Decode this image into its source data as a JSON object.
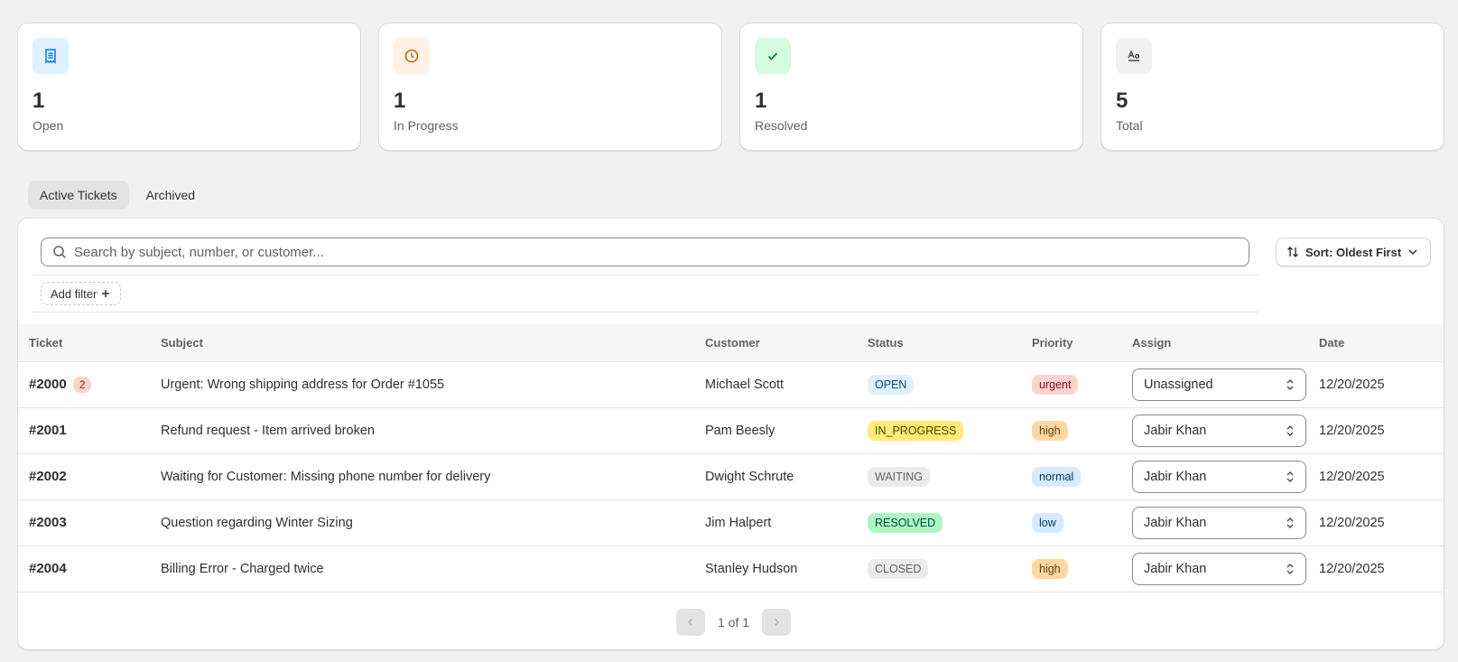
{
  "stats": [
    {
      "value": "1",
      "label": "Open",
      "icon": "receipt-icon",
      "icon_bg": "#e0f0ff",
      "icon_color": "#0b7bd9"
    },
    {
      "value": "1",
      "label": "In Progress",
      "icon": "clock-icon",
      "icon_bg": "#fff1e3",
      "icon_color": "#b8700a"
    },
    {
      "value": "1",
      "label": "Resolved",
      "icon": "check-icon",
      "icon_bg": "#d4fbdf",
      "icon_color": "#0c7a3b"
    },
    {
      "value": "5",
      "label": "Total",
      "icon": "text-format-icon",
      "icon_bg": "#f1f1f1",
      "icon_color": "#4a4a4a"
    }
  ],
  "tabs": [
    "Active Tickets",
    "Archived"
  ],
  "search": {
    "placeholder": "Search by subject, number, or customer..."
  },
  "sort": {
    "label": "Sort: Oldest First"
  },
  "filter": {
    "add_label": "Add filter"
  },
  "table": {
    "columns": [
      "Ticket",
      "Subject",
      "Customer",
      "Status",
      "Priority",
      "Assign",
      "Date"
    ],
    "rows": [
      {
        "ticket": "#2000",
        "count": "2",
        "subject": "Urgent: Wrong shipping address for Order #1055",
        "customer": "Michael Scott",
        "status": "OPEN",
        "priority": "urgent",
        "assign": "Unassigned",
        "date": "12/20/2025"
      },
      {
        "ticket": "#2001",
        "count": "",
        "subject": "Refund request - Item arrived broken",
        "customer": "Pam Beesly",
        "status": "IN_PROGRESS",
        "priority": "high",
        "assign": "Jabir Khan",
        "date": "12/20/2025"
      },
      {
        "ticket": "#2002",
        "count": "",
        "subject": "Waiting for Customer: Missing phone number for delivery",
        "customer": "Dwight Schrute",
        "status": "WAITING",
        "priority": "normal",
        "assign": "Jabir Khan",
        "date": "12/20/2025"
      },
      {
        "ticket": "#2003",
        "count": "",
        "subject": "Question regarding Winter Sizing",
        "customer": "Jim Halpert",
        "status": "RESOLVED",
        "priority": "low",
        "assign": "Jabir Khan",
        "date": "12/20/2025"
      },
      {
        "ticket": "#2004",
        "count": "",
        "subject": "Billing Error - Charged twice",
        "customer": "Stanley Hudson",
        "status": "CLOSED",
        "priority": "high",
        "assign": "Jabir Khan",
        "date": "12/20/2025"
      }
    ]
  },
  "status_colors": {
    "OPEN": {
      "bg": "#e0f0ff",
      "fg": "#00527c"
    },
    "IN_PROGRESS": {
      "bg": "#ffeb78",
      "fg": "#4f4700"
    },
    "WAITING": {
      "bg": "#ebebeb",
      "fg": "#616161"
    },
    "RESOLVED": {
      "bg": "#aff4c6",
      "fg": "#014b40"
    },
    "CLOSED": {
      "bg": "#ebebeb",
      "fg": "#616161"
    }
  },
  "priority_colors": {
    "urgent": {
      "bg": "#fed3d1",
      "fg": "#8e0b21"
    },
    "high": {
      "bg": "#ffd6a4",
      "fg": "#5e4200"
    },
    "normal": {
      "bg": "#d5ebff",
      "fg": "#003a5a"
    },
    "low": {
      "bg": "#d5ebff",
      "fg": "#003a5a"
    }
  },
  "pagination": {
    "text": "1 of 1"
  }
}
